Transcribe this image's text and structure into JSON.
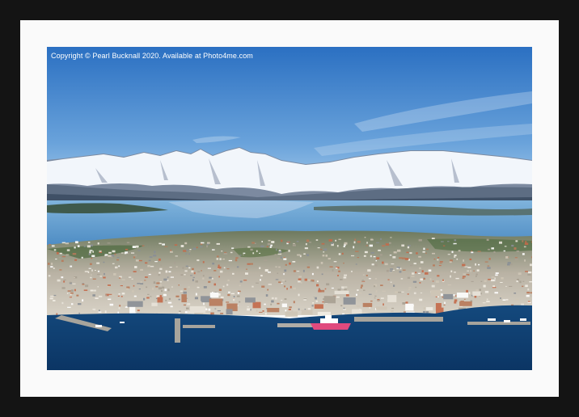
{
  "artwork": {
    "copyright_text": "Copyright © Pearl Bucknall 2020. Available at Photo4me.com",
    "subject": "Aerial view of harbour town with snow-capped mountains across a fjord",
    "palette": {
      "frame": "#141414",
      "mount": "#fafafa",
      "sky_top": "#2f79c8",
      "sky_horizon": "#b9d6ee",
      "snow": "#f4f7fb",
      "rock": "#6f7f96",
      "fjord": "#6aa5d3",
      "harbour_water": "#0f3f70",
      "town": "#d9d3c8",
      "ship": "#e04a7e"
    }
  }
}
